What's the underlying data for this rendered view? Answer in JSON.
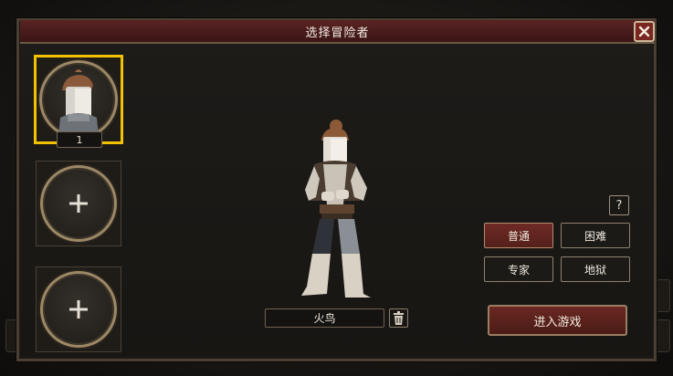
{
  "dialog": {
    "title": "选择冒险者"
  },
  "slots": [
    {
      "state": "selected",
      "level": "1"
    },
    {
      "state": "empty"
    },
    {
      "state": "empty"
    }
  ],
  "hero": {
    "name": "火鸟"
  },
  "help": {
    "label": "?"
  },
  "difficulty": {
    "options": [
      "普通",
      "困难",
      "专家",
      "地狱"
    ],
    "selected": "普通"
  },
  "actions": {
    "enter_game": "进入游戏"
  },
  "colors": {
    "accent_selected": "#f2c200",
    "title_bar": "#5a2323",
    "button_active": "#6e2a24"
  },
  "icons": {
    "close": "close-icon",
    "delete": "trash-icon",
    "add": "plus-icon"
  }
}
